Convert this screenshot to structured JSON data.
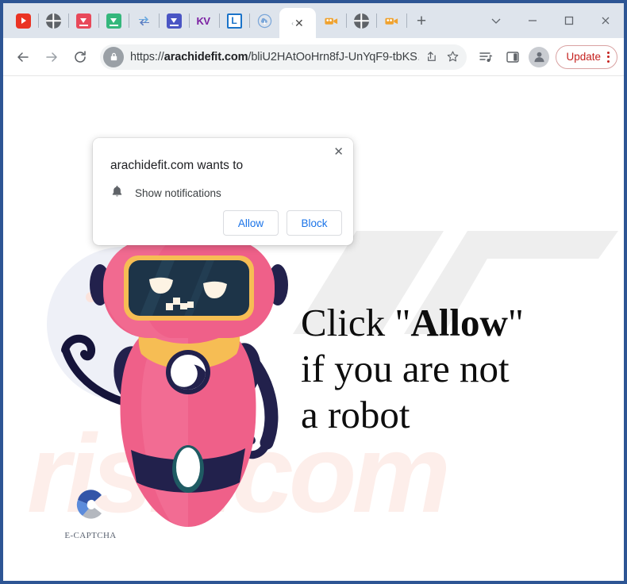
{
  "window": {
    "controls": [
      {
        "name": "chevron-down",
        "glyph": "⌄"
      },
      {
        "name": "minimize",
        "glyph": "–"
      },
      {
        "name": "maximize",
        "glyph": "□"
      },
      {
        "name": "close",
        "glyph": "✕"
      }
    ]
  },
  "tabs": [
    {
      "name": "youtube",
      "label": "YouTube",
      "kind": "youtube"
    },
    {
      "name": "globe-1",
      "label": "Web page",
      "kind": "globe"
    },
    {
      "name": "downloader-red",
      "label": "Downloader",
      "kind": "dl-red"
    },
    {
      "name": "downloader-green",
      "label": "Downloader",
      "kind": "dl-green"
    },
    {
      "name": "sync",
      "label": "Sync",
      "kind": "sync"
    },
    {
      "name": "downloader-blue",
      "label": "Downloader",
      "kind": "dl-blue"
    },
    {
      "name": "kv",
      "label": "KV",
      "kind": "kv"
    },
    {
      "name": "l-site",
      "label": "L",
      "kind": "l"
    },
    {
      "name": "cloud-download",
      "label": "Cloud download",
      "kind": "cloud"
    },
    {
      "name": "active-tab",
      "label": "",
      "kind": "active",
      "active": true
    },
    {
      "name": "camera-1",
      "label": "Video",
      "kind": "cam"
    },
    {
      "name": "globe-2",
      "label": "Web page",
      "kind": "globe"
    },
    {
      "name": "camera-2",
      "label": "Video",
      "kind": "cam"
    }
  ],
  "new_tab": {
    "label": "+",
    "title": "New tab"
  },
  "toolbar": {
    "back": "←",
    "forward": "→",
    "reload": "↻",
    "url_prefix": "https://",
    "url_domain": "arachidefit.com",
    "url_path": "/bliU2HAtOoHrn8fJ-UnYqF9-tbKS…",
    "url_full": "https://arachidefit.com/bliU2HAtOoHrn8fJ-UnYqF9-tbKS…",
    "update_label": "Update",
    "accent_update": "#c5221f"
  },
  "dialog": {
    "title": "arachidefit.com wants to",
    "permission": "Show notifications",
    "allow_label": "Allow",
    "block_label": "Block",
    "close_glyph": "✕",
    "accent": "#1a73e8"
  },
  "content": {
    "headline_part1": "Click \"",
    "headline_bold": "Allow",
    "headline_part2": "\"\nif you are not\na robot",
    "captcha_label": "E-CAPTCHA",
    "watermark_text": "risk.com",
    "colors": {
      "robot_body": "#ef6089",
      "robot_dark": "#222145",
      "robot_gold": "#f6bd54",
      "visor": "#1d3448",
      "eye": "#fdf3e4",
      "bg_circle": "#eef0f7",
      "captcha_blue_dark": "#3355a8",
      "captcha_blue_light": "#5b8bdb",
      "captcha_gray": "#b4b8bf"
    }
  }
}
